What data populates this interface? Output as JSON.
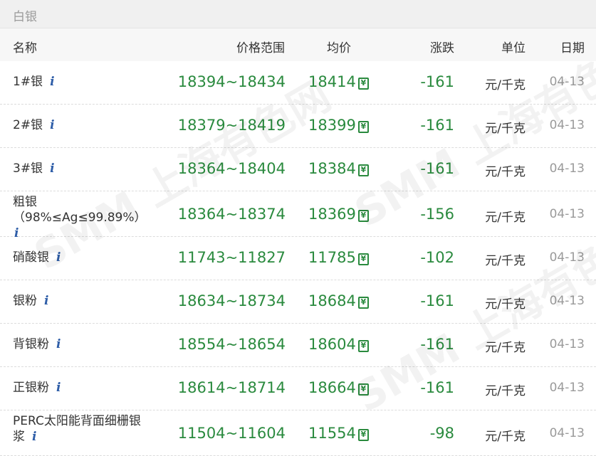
{
  "section_title": "白银",
  "columns": {
    "name": "名称",
    "range": "价格范围",
    "avg": "均价",
    "change": "涨跌",
    "unit": "单位",
    "date": "日期"
  },
  "currency_icon": "¥",
  "rows": [
    {
      "name": "1#银",
      "range": "18394~18434",
      "avg": "18414",
      "change": "-161",
      "unit": "元/千克",
      "date": "04-13"
    },
    {
      "name": "2#银",
      "range": "18379~18419",
      "avg": "18399",
      "change": "-161",
      "unit": "元/千克",
      "date": "04-13"
    },
    {
      "name": "3#银",
      "range": "18364~18404",
      "avg": "18384",
      "change": "-161",
      "unit": "元/千克",
      "date": "04-13"
    },
    {
      "name": "粗银（98%≤Ag≤99.89%）",
      "range": "18364~18374",
      "avg": "18369",
      "change": "-156",
      "unit": "元/千克",
      "date": "04-13"
    },
    {
      "name": "硝酸银",
      "range": "11743~11827",
      "avg": "11785",
      "change": "-102",
      "unit": "元/千克",
      "date": "04-13"
    },
    {
      "name": "银粉",
      "range": "18634~18734",
      "avg": "18684",
      "change": "-161",
      "unit": "元/千克",
      "date": "04-13"
    },
    {
      "name": "背银粉",
      "range": "18554~18654",
      "avg": "18604",
      "change": "-161",
      "unit": "元/千克",
      "date": "04-13"
    },
    {
      "name": "正银粉",
      "range": "18614~18714",
      "avg": "18664",
      "change": "-161",
      "unit": "元/千克",
      "date": "04-13"
    },
    {
      "name": "PERC太阳能背面细栅银浆",
      "range": "11504~11604",
      "avg": "11554",
      "change": "-98",
      "unit": "元/千克",
      "date": "04-13"
    }
  ],
  "watermark": "SMM 上海有色网"
}
